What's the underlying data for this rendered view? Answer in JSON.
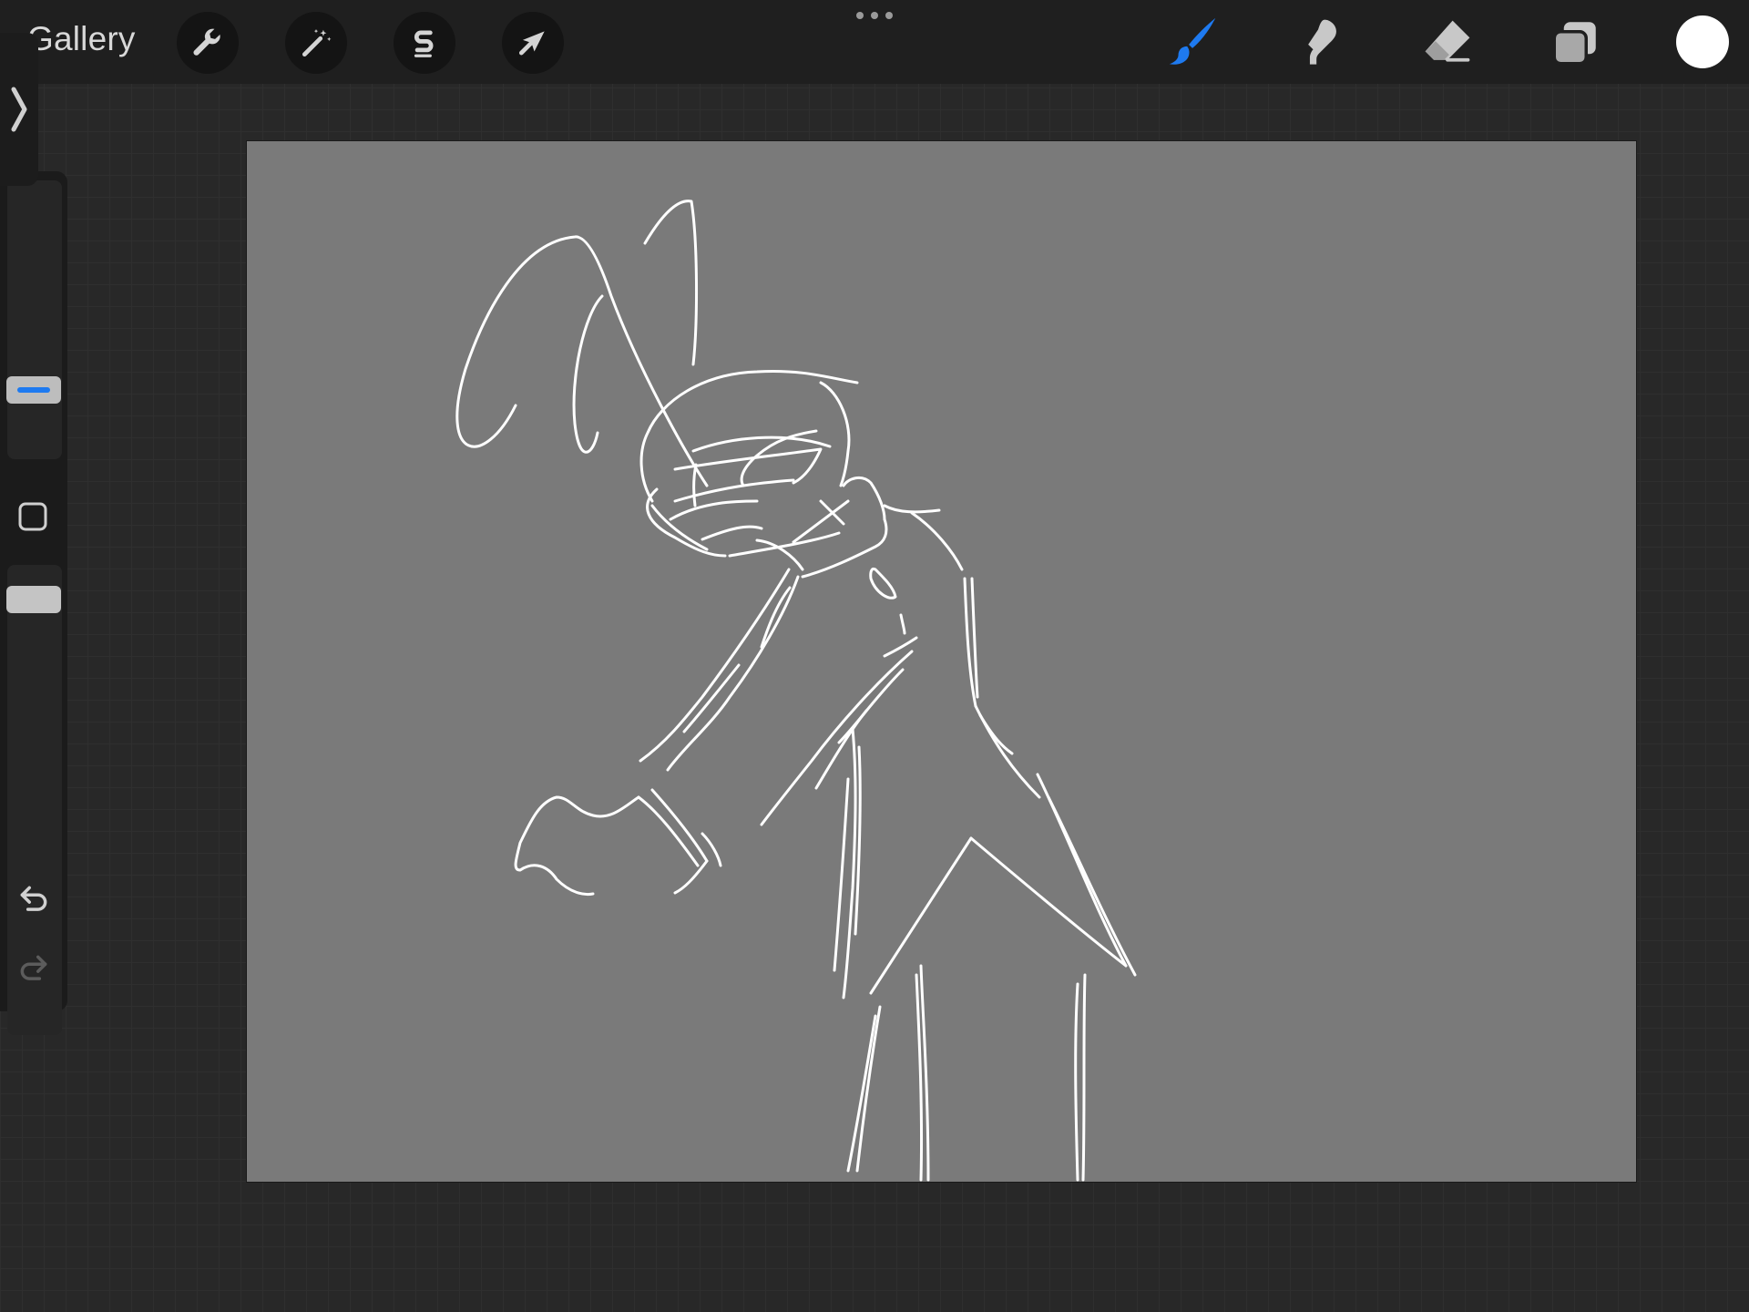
{
  "topbar": {
    "gallery_label": "Gallery",
    "left_tools": [
      {
        "name": "actions",
        "icon": "wrench-icon"
      },
      {
        "name": "adjustments",
        "icon": "magic-wand-icon"
      },
      {
        "name": "selection",
        "icon": "selection-s-icon"
      },
      {
        "name": "transform",
        "icon": "arrow-cursor-icon"
      }
    ],
    "right_tools": [
      {
        "name": "brush",
        "icon": "brush-icon",
        "active": true
      },
      {
        "name": "smudge",
        "icon": "smudge-finger-icon",
        "active": false
      },
      {
        "name": "eraser",
        "icon": "eraser-icon",
        "active": false
      },
      {
        "name": "layers",
        "icon": "layers-icon",
        "active": false
      }
    ],
    "current_color": "#ffffff"
  },
  "sidebar": {
    "brush_size_accent": "#1e7af0",
    "icons": [
      "chevron-right-icon",
      "square-modify-icon",
      "undo-icon",
      "redo-icon"
    ]
  },
  "canvas": {
    "background": "#7a7a7a",
    "stroke_color": "#ffffff"
  },
  "colors": {
    "accent": "#1e7af0",
    "toolbar_bg": "#1f1f1f",
    "workspace_bg": "#282828"
  }
}
